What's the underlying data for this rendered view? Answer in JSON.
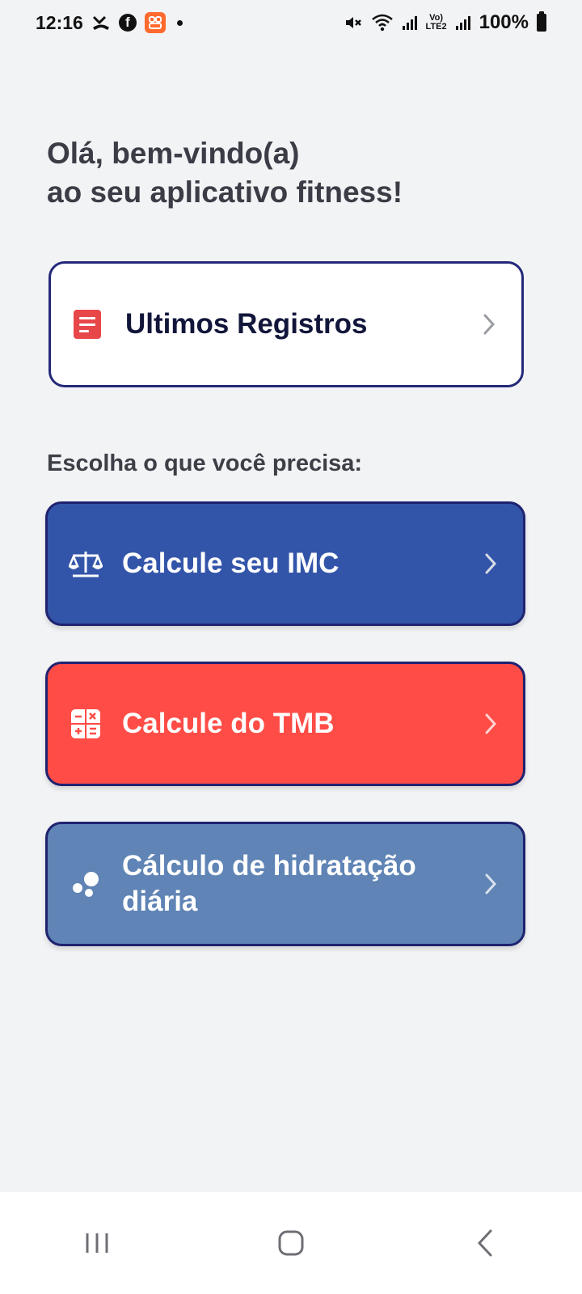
{
  "status_bar": {
    "time": "12:16",
    "battery": "100%",
    "network_label": "Vo)\nLTE2",
    "icons": [
      "missed-call-icon",
      "facebook-icon",
      "app-notification-icon",
      "notification-dot-icon",
      "mute-icon",
      "wifi-icon",
      "signal-icon",
      "volte-lte2-icon",
      "signal-icon",
      "battery-icon"
    ]
  },
  "greeting": {
    "line1": "Olá, bem-vindo(a)",
    "line2": "ao seu aplicativo fitness!"
  },
  "records_card": {
    "label": "Ultimos Registros",
    "icon": "document-icon"
  },
  "section_title": "Escolha o que você precisa:",
  "actions": [
    {
      "label": "Calcule seu IMC",
      "icon": "scale-icon",
      "color": "#3355A9"
    },
    {
      "label": "Calcule do TMB",
      "icon": "calculator-icon",
      "color": "#FF4C46"
    },
    {
      "label": "Cálculo de hidratação diária",
      "icon": "drops-icon",
      "color": "#5F84B5"
    }
  ],
  "colors": {
    "background": "#F2F3F5",
    "border": "#25297A",
    "records_icon": "#E8474A"
  },
  "nav_bar": {
    "items": [
      "recent-apps-icon",
      "home-icon",
      "back-icon"
    ]
  }
}
